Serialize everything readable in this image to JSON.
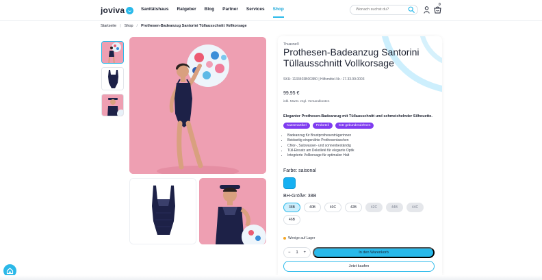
{
  "header": {
    "logo_text": "joviva",
    "nav": [
      "Sanitätshaus",
      "Ratgeber",
      "Blog",
      "Partner",
      "Services",
      "Shop"
    ],
    "active_nav": "Shop",
    "search_placeholder": "Wonach suchst du?",
    "cart_count": "0"
  },
  "breadcrumb": [
    "Startseite",
    "Shop",
    "Prothesen-Badeanzug Santorini Tüllausschnitt Vollkorsage"
  ],
  "product": {
    "brand": "Thuasne®",
    "title": "Prothesen-Badeanzug Santorini Tüllausschnitt Vollkorsage",
    "sku": "SKU: 1133403B003B0  |  Hilfsmittel-Nr.: 17.33.99.0003",
    "price": "99,95 €",
    "tax_note": "inkl. MwSt. zzgl. Versandkosten",
    "description": "Eleganter Prothesen-Badeanzug mit Tüllausschnitt und schmeichelnder Silhouette.",
    "tags": [
      "Kassenartikel",
      "Probeteil",
      "ICD gebundendzhnen"
    ],
    "bullets": [
      "Badeanzug für Brustprothesenträgerinnen",
      "Beidseitig eingenähte Prothesentaschen",
      "Chlor-, Salzwasser- und sonnenbeständig",
      "Tüll-Einsatz am Dekolleté für elegante Optik",
      "Integrierte Vollkorsage für optimalen Halt"
    ],
    "color_label": "Farbe: saisonal",
    "color_swatch": "#16b0f2",
    "size_label": "BH-Größe: 38B",
    "sizes": [
      {
        "label": "38B",
        "state": "selected"
      },
      {
        "label": "40B",
        "state": "available"
      },
      {
        "label": "40C",
        "state": "available"
      },
      {
        "label": "42B",
        "state": "available"
      },
      {
        "label": "42C",
        "state": "unavailable"
      },
      {
        "label": "44B",
        "state": "unavailable"
      },
      {
        "label": "44C",
        "state": "unavailable"
      },
      {
        "label": "46B",
        "state": "available"
      }
    ],
    "stock_text": "Wenige auf Lager",
    "quantity": "1",
    "qty_minus": "−",
    "qty_plus": "+",
    "add_to_cart": "In den Warenkorb",
    "buy_now": "Jetzt kaufen"
  },
  "colors": {
    "accent": "#29b9ea",
    "tag": "#7f3cf0",
    "photo_bg": "#ee9fb2",
    "swimsuit": "#1d2147"
  }
}
